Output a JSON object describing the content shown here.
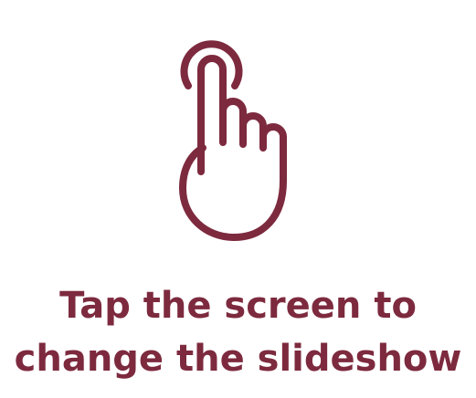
{
  "screen": {
    "icon": "tap-gesture-icon",
    "accent_color": "#7d2a3e",
    "background_color": "#ffffff",
    "instruction_line_1": "Tap the screen to",
    "instruction_line_2": "change the slideshow"
  }
}
